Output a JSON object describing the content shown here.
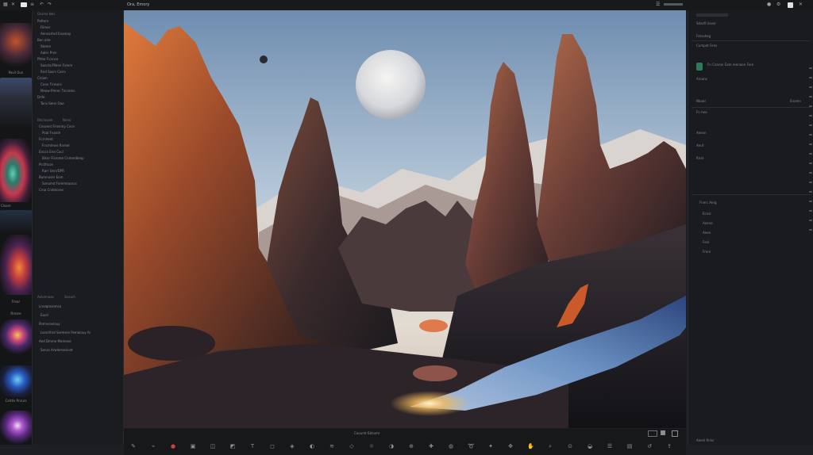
{
  "canvas": {
    "title": "Ora, Emory"
  },
  "topbar": {
    "left_icons": [
      "grid-icon",
      "close-icon",
      "undo-icon",
      "camera-icon",
      "panel-icon"
    ],
    "right_icons": [
      "user-icon",
      "settings-icon",
      "help-icon",
      "close-icon"
    ]
  },
  "left_panel": {
    "group1_rows": [
      "Pattern",
      "Filmer",
      "Aenearted Enamay",
      "Ben alre",
      "Stome",
      "Aaler Pren",
      "Pttler Fcnnce",
      "Sancts/FNner Fomm",
      "Rnd Sasrs Corrs",
      "Cnlam",
      "Cnen Tnmers",
      "Meaw-Pmrer Tncroms",
      "Dnfe",
      "Tons-Senc-Oae"
    ],
    "group1_heads": [
      "Oarme Nes"
    ],
    "group2_heads": [
      "Bhclnsem",
      "Nimo"
    ],
    "group2_rows": [
      "Cnssent Frrenmy Cnce",
      "Poal Fnanm",
      "Fcrnlrent",
      "Fncmlmes Rnmel",
      "Enccn Erel Cocl",
      "Blcor Fisrome Cnmerdleep",
      "Pccthcon",
      "Rarr Uerr/DPR",
      "Bumnoser Eem",
      "Sonumd Fommeaoscs",
      "Crna Cndnlcses"
    ],
    "group3_heads": [
      "Aelonnoas",
      "Seoum"
    ],
    "group3_rows": [
      "Lrneqmsemsa",
      "Eacd",
      "Pomnsaeiouy",
      "Lsesrttnd Sermere Pemeiouy fo",
      "Aed Dmme Memeee",
      "Senss Arwlemaniont"
    ]
  },
  "thumbs": {
    "labels": [
      "Pavil Oun",
      "Clsure",
      "Fmar",
      "Rmore",
      "Calrtiv Pnrurs"
    ]
  },
  "right_panel": {
    "header": "Sdasfl Ueser",
    "rows_top": [
      "Fetsaheg",
      "Cumpet Fens",
      "Aroans",
      "Nbaer",
      "Fn hee"
    ],
    "card_text": "Fn Cnaron Eam reenaen Fere",
    "rows_mid": [
      "Aeeon",
      "Aeuf",
      "Rnal"
    ],
    "section2_head": "Fnerc Aerg",
    "rows_low": [
      "Ecnsl",
      "Aeeno",
      "Aeee",
      "Feol",
      "Fmrn"
    ],
    "rows_bottom": [
      "Aeenl Rnlsr"
    ],
    "side_values": [
      "Enomn",
      "Gmnnm",
      "Eoou",
      "Elo",
      "Sbe"
    ]
  },
  "bottom_bar": {
    "status": "Ceoumt  Ebhomr",
    "icons": [
      "pen-icon",
      "brush-icon",
      "eraser-icon",
      "layers-icon",
      "crop-icon",
      "transform-icon",
      "text-icon",
      "shape-icon",
      "fill-icon",
      "gradient-icon",
      "blur-icon",
      "sharpen-icon",
      "dodge-icon",
      "burn-icon",
      "clone-icon",
      "heal-icon",
      "stamp-icon",
      "lasso-icon",
      "wand-icon",
      "move-icon",
      "hand-icon",
      "zoom-icon",
      "eyedropper-icon",
      "mask-icon",
      "adjust-icon",
      "filter-icon",
      "history-icon",
      "export-icon"
    ]
  }
}
